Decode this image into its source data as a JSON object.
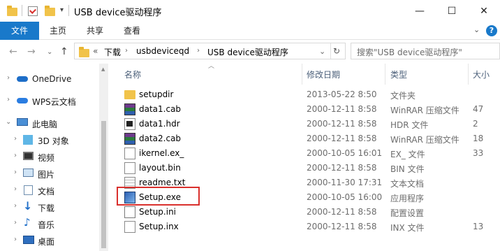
{
  "window": {
    "title": "USB device驱动程序",
    "minimize_glyph": "—",
    "maximize_glyph": "☐",
    "close_glyph": "✕"
  },
  "ribbon": {
    "tabs": [
      {
        "label": "文件",
        "active": true
      },
      {
        "label": "主页"
      },
      {
        "label": "共享"
      },
      {
        "label": "查看"
      }
    ],
    "expand_glyph": "⌄",
    "help_glyph": "?"
  },
  "address": {
    "overflow": "«",
    "crumbs": [
      "下载",
      "usbdeviceqd",
      "USB device驱动程序"
    ],
    "refresh_glyph": "↻",
    "dropdown_glyph": "⌄"
  },
  "search": {
    "placeholder": "搜索\"USB device驱动程序\""
  },
  "nav": {
    "items": [
      {
        "label": "OneDrive",
        "icon": "cloud-icon"
      },
      {
        "label": "WPS云文档",
        "icon": "cloud-icon"
      },
      {
        "label": "此电脑",
        "icon": "computer-icon"
      },
      {
        "label": "3D 对象",
        "icon": "3d-objects-icon"
      },
      {
        "label": "视频",
        "icon": "video-icon"
      },
      {
        "label": "图片",
        "icon": "pictures-icon"
      },
      {
        "label": "文档",
        "icon": "documents-icon"
      },
      {
        "label": "下载",
        "icon": "download-icon"
      },
      {
        "label": "音乐",
        "icon": "music-icon"
      },
      {
        "label": "桌面",
        "icon": "desktop-icon"
      }
    ]
  },
  "columns": {
    "name": "名称",
    "date": "修改日期",
    "type": "类型",
    "size": "大小"
  },
  "files": [
    {
      "name": "setupdir",
      "date": "2013-05-22 8:50",
      "type": "文件夹",
      "size": "",
      "icon": "folder-icon"
    },
    {
      "name": "data1.cab",
      "date": "2000-12-11 8:58",
      "type": "WinRAR 压缩文件",
      "size": "47",
      "icon": "winrar-icon"
    },
    {
      "name": "data1.hdr",
      "date": "2000-12-11 8:58",
      "type": "HDR 文件",
      "size": "2",
      "icon": "file-icon"
    },
    {
      "name": "data2.cab",
      "date": "2000-12-11 8:58",
      "type": "WinRAR 压缩文件",
      "size": "18",
      "icon": "winrar-icon"
    },
    {
      "name": "ikernel.ex_",
      "date": "2000-10-05 16:01",
      "type": "EX_ 文件",
      "size": "33",
      "icon": "file-icon"
    },
    {
      "name": "layout.bin",
      "date": "2000-12-11 8:58",
      "type": "BIN 文件",
      "size": "",
      "icon": "file-icon"
    },
    {
      "name": "readme.txt",
      "date": "2000-11-30 17:31",
      "type": "文本文档",
      "size": "",
      "icon": "text-file-icon"
    },
    {
      "name": "Setup.exe",
      "date": "2000-10-05 16:00",
      "type": "应用程序",
      "size": "",
      "icon": "setup-exe-icon",
      "highlighted": true
    },
    {
      "name": "Setup.ini",
      "date": "2000-12-11 8:58",
      "type": "配置设置",
      "size": "",
      "icon": "settings-file-icon"
    },
    {
      "name": "Setup.inx",
      "date": "2000-12-11 8:58",
      "type": "INX 文件",
      "size": "13",
      "icon": "file-icon"
    }
  ],
  "colors": {
    "accent": "#1979ca",
    "highlight_border": "#d9302d",
    "folder": "#f1c34a"
  }
}
